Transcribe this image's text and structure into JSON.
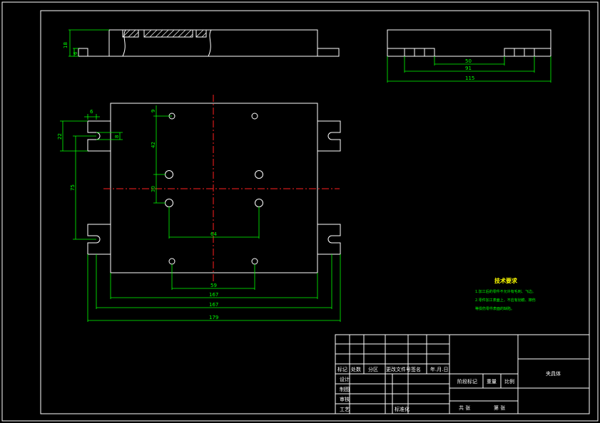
{
  "colors": {
    "background": "#000000",
    "outline": "#ffffff",
    "dimension": "#00ff00",
    "centerline": "#ff2020",
    "heading": "#ffff00"
  },
  "side_view_dims": {
    "d1": "18",
    "d2": "6"
  },
  "right_view_dims": {
    "d1": "50",
    "d2": "91",
    "d3": "115"
  },
  "plan_dims": {
    "top_6": "6",
    "left_22": "22",
    "slot_8": "8",
    "left_75": "75",
    "hole_9": "9",
    "hole_42": "42",
    "hole_30": "30",
    "holes_64": "64",
    "holes_59": "59",
    "width_167a": "167",
    "width_167b": "167",
    "width_179": "179"
  },
  "tech_notes": {
    "heading": "技术要求",
    "line1": "1.加工后的零件不允许有毛刺、飞边。",
    "line2": "2.零件加工表面上，不应有划痕、擦伤",
    "line3": "等损伤零件表面的缺陷。"
  },
  "title_block": {
    "title": "夹具体",
    "row_labels": [
      "标记",
      "处数",
      "分区",
      "更改文件号",
      "签名",
      "年.月.日"
    ],
    "left_labels": [
      "设计",
      "制图",
      "审核",
      "工艺"
    ],
    "standardize": "标准化",
    "stage_mark": "阶段标记",
    "weight": "重量",
    "scale": "比例",
    "sheets_total": "共 张",
    "sheet_no": "第 张"
  }
}
